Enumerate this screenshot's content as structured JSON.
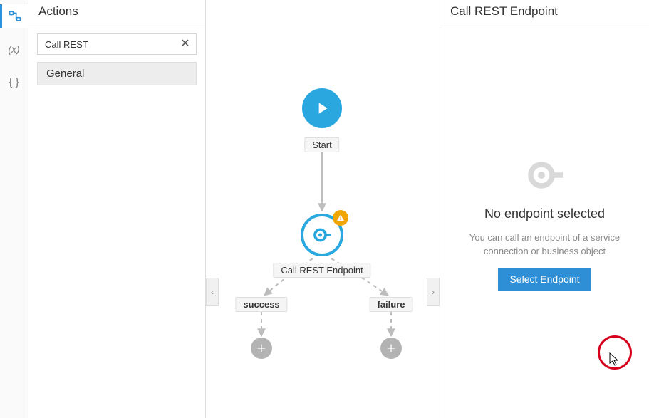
{
  "rail": {
    "items": [
      {
        "name": "actions-icon"
      },
      {
        "name": "variables-icon"
      },
      {
        "name": "types-icon"
      }
    ]
  },
  "actions": {
    "title": "Actions",
    "search_value": "Call REST",
    "search_placeholder": "Filter",
    "categories": [
      "General"
    ]
  },
  "flow": {
    "start": {
      "label": "Start"
    },
    "rest": {
      "label": "Call REST Endpoint",
      "warning": true
    },
    "branches": [
      {
        "label": "success"
      },
      {
        "label": "failure"
      }
    ]
  },
  "props": {
    "title": "Call REST Endpoint",
    "empty_title": "No endpoint selected",
    "empty_desc": "You can call an endpoint of a service connection or business object",
    "button": "Select Endpoint"
  },
  "colors": {
    "accent": "#2aa7df",
    "primary_btn": "#2f8fd6",
    "warning": "#f0a500",
    "annotation": "#d6001c"
  }
}
